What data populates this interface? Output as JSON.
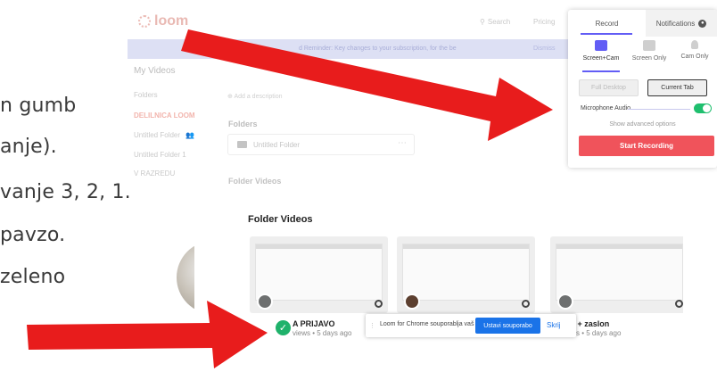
{
  "slide": {
    "lines": [
      "n gumb",
      "anje).",
      "vanje 3, 2, 1.",
      " pavzo.",
      "zeleno"
    ]
  },
  "loom_top": {
    "logo": "loom",
    "search": "Search",
    "pricing": "Pricing",
    "banner_text": "d Reminder: Key changes to your subscription, for the be",
    "banner_dismiss": "Dismiss",
    "sidebar": {
      "title": "My Videos",
      "items": [
        "Folders",
        "DELILNICA LOOM",
        "Untitled Folder",
        "Untitled Folder 1",
        "V RAZREDU"
      ]
    },
    "add_description": "Add a description",
    "folders_heading": "Folders",
    "folder_name": "Untitled Folder",
    "folder_videos_heading": "Folder Videos"
  },
  "popup": {
    "tabs": {
      "record": "Record",
      "notifications": "Notifications"
    },
    "modes": [
      "Screen+Cam",
      "Screen Only",
      "Cam Only"
    ],
    "sub_options": [
      "Full Desktop",
      "Current Tab"
    ],
    "mic_label": "Microphone Audio",
    "advanced": "Show advanced options",
    "start_button": "Start Recording",
    "accent": "#625df5",
    "start_color": "#f0535b"
  },
  "loom_bottom": {
    "heading": "Folder Videos",
    "videos": [
      {
        "title": "A PRIJAVO",
        "meta": "views • 5 days ago"
      },
      {
        "title": "",
        "meta": ""
      },
      {
        "title": "a + zaslon",
        "meta": "views • 5 days ago"
      }
    ]
  },
  "share_bar": {
    "text": "Loom for Chrome souporablja vaš zaslon.",
    "stop_button": "Ustavi souporabo",
    "hide_link": "Skrij"
  },
  "colors": {
    "arrow": "#e81c1c",
    "check": "#1fb26b"
  }
}
